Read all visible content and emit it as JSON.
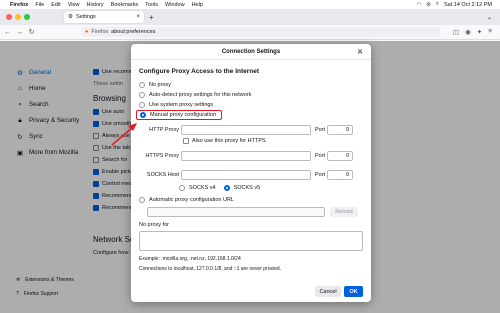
{
  "menubar": {
    "app": "Firefox",
    "items": [
      "File",
      "Edit",
      "View",
      "History",
      "Bookmarks",
      "Tools",
      "Window",
      "Help"
    ],
    "datetime": "Sat 14 Oct 2:12 PM"
  },
  "tab": {
    "title": "Settings"
  },
  "urlbar": {
    "identity": "Firefox",
    "url": "about:preferences"
  },
  "sidebar": {
    "items": [
      {
        "label": "General",
        "icon": "gear-icon"
      },
      {
        "label": "Home",
        "icon": "home-icon"
      },
      {
        "label": "Search",
        "icon": "search-icon"
      },
      {
        "label": "Privacy & Security",
        "icon": "lock-icon"
      },
      {
        "label": "Sync",
        "icon": "sync-icon"
      },
      {
        "label": "More from Mozilla",
        "icon": "mozilla-icon"
      }
    ],
    "footer": [
      {
        "label": "Extensions & Themes",
        "icon": "puzzle-icon"
      },
      {
        "label": "Firefox Support",
        "icon": "help-icon"
      }
    ]
  },
  "background": {
    "items_top": [
      "Use recomm",
      "These settin"
    ],
    "browsing_heading": "Browsing",
    "checks": [
      "Use auto",
      "Use smooth",
      "Always use",
      "Use the tab",
      "Search for",
      "Enable pictu",
      "Control med",
      "Recommend",
      "Recommend"
    ],
    "network_heading": "Network Se",
    "network_text": "Configure how"
  },
  "dialog": {
    "title": "Connection Settings",
    "heading": "Configure Proxy Access to the Internet",
    "options": {
      "no_proxy": "No proxy",
      "auto_detect": "Auto-detect proxy settings for this network",
      "system": "Use system proxy settings",
      "manual": "Manual proxy configuration"
    },
    "http_proxy_label": "HTTP Proxy",
    "https_proxy_label": "HTTPS Proxy",
    "socks_host_label": "SOCKS Host",
    "port_label": "Port",
    "http_port": "0",
    "https_port": "0",
    "socks_port": "0",
    "also_https": "Also use this proxy for HTTPS",
    "socks_v4": "SOCKS v4",
    "socks_v5": "SOCKS v5",
    "auto_config_label": "Automatic proxy configuration URL",
    "reload_label": "Reload",
    "no_proxy_for_label": "No proxy for",
    "example": "Example: .mozilla.org, .net.nz, 192.168.1.0/24",
    "localhost_note": "Connections to localhost, 127.0.0.1/8, and ::1 are never proxied.",
    "cancel_label": "Cancel",
    "ok_label": "OK"
  },
  "colors": {
    "accent": "#0061e0",
    "highlight": "#e01b24"
  }
}
